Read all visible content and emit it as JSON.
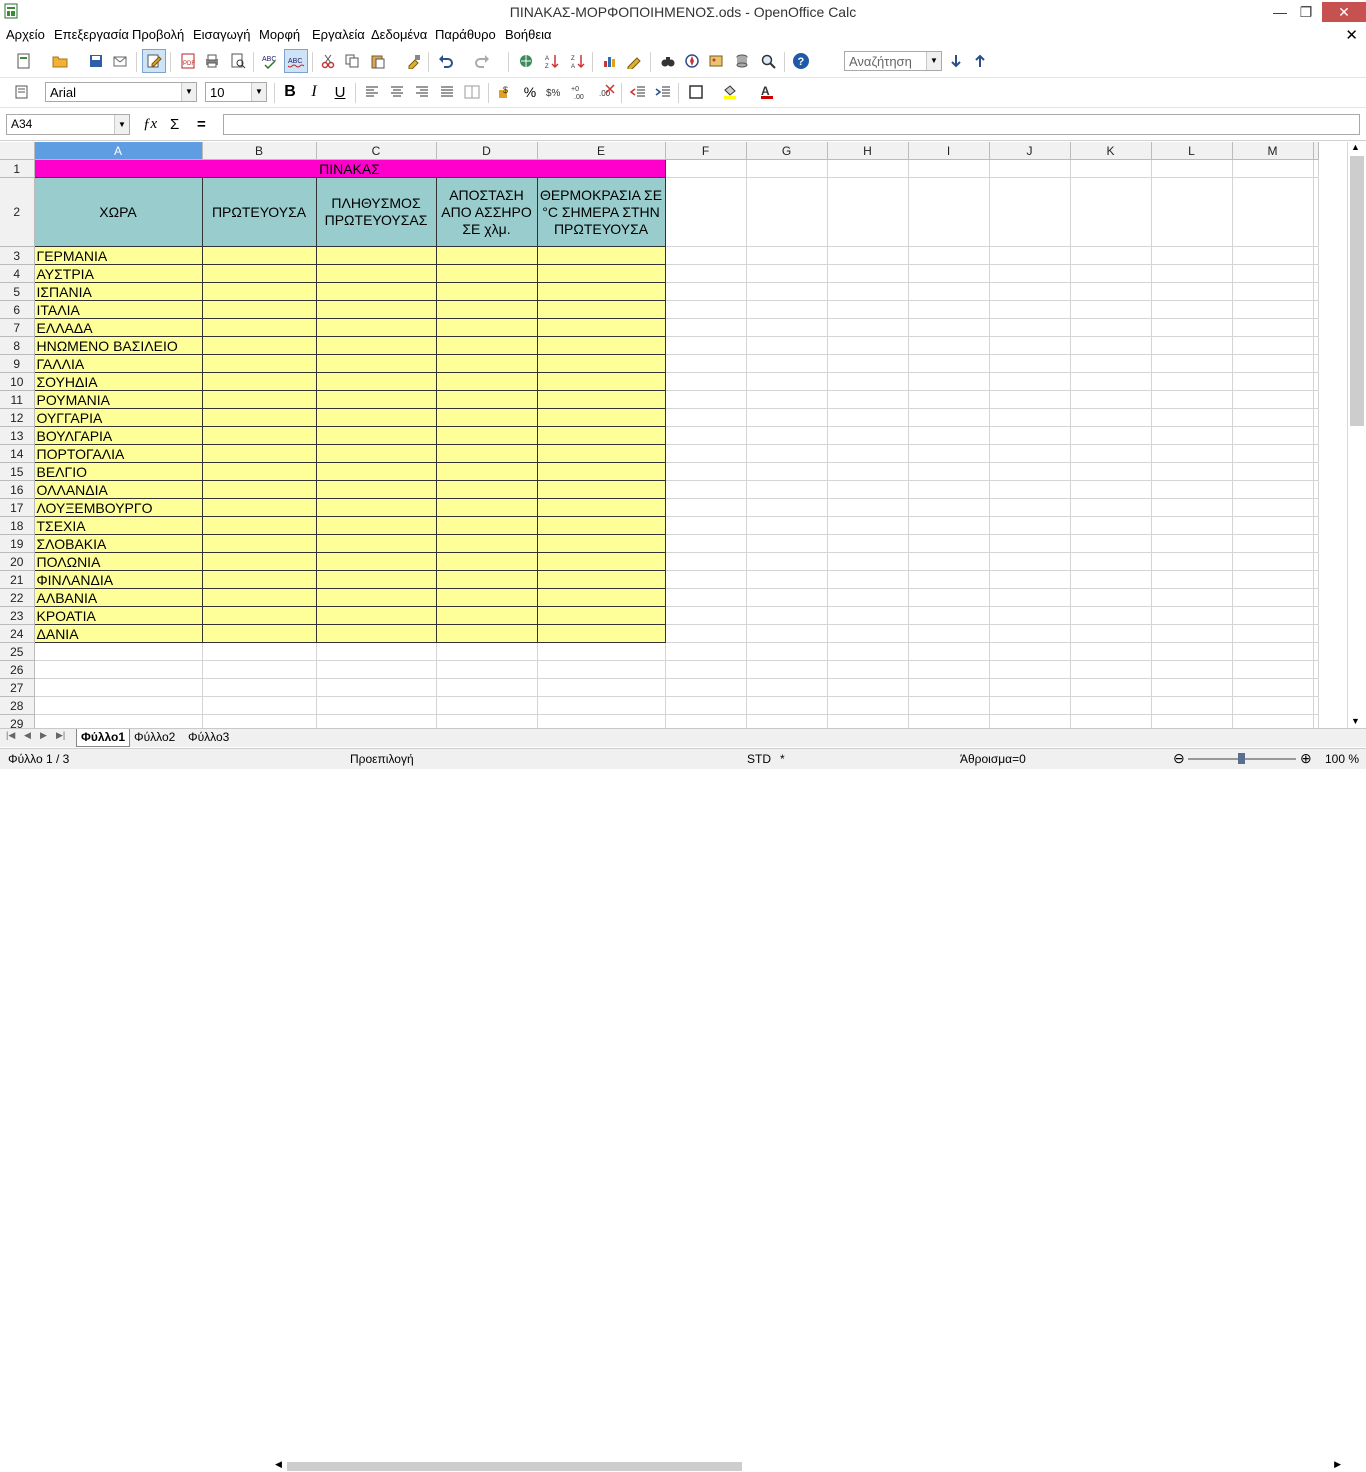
{
  "window": {
    "title": "ΠΙΝΑΚΑΣ-ΜΟΡΦΟΠΟΙΗΜΕΝΟΣ.ods - OpenOffice Calc",
    "minimize": "—",
    "maximize": "❐",
    "close": "✕"
  },
  "menu": [
    "Αρχείο",
    "Επεξεργασία",
    "Προβολή",
    "Εισαγωγή",
    "Μορφή",
    "Εργαλεία",
    "Δεδομένα",
    "Παράθυρο",
    "Βοήθεια"
  ],
  "toolbar": {
    "search_value": "Αναζήτηση",
    "font_name": "Arial",
    "font_size": "10"
  },
  "formula_bar": {
    "name_box": "A34",
    "equals": "="
  },
  "columns": [
    "A",
    "B",
    "C",
    "D",
    "E",
    "F",
    "G",
    "H",
    "I",
    "J",
    "K",
    "L",
    "M"
  ],
  "sheet": {
    "title_cell": "ΠΙΝΑΚΑΣ",
    "headers": [
      "ΧΩΡΑ",
      "ΠΡΩΤΕΥΟΥΣΑ",
      "ΠΛΗΘΥΣΜΟΣ ΠΡΩΤΕΥΟΥΣΑΣ",
      "ΑΠΟΣΤΑΣΗ ΑΠΟ ΑΣΣΗΡΟ ΣΕ χλμ.",
      "ΘΕΡΜΟΚΡΑΣΙΑ ΣΕ °C ΣΗΜΕΡΑ ΣΤΗΝ ΠΡΩΤΕΥΟΥΣΑ"
    ],
    "countries": [
      "ΓΕΡΜΑΝΙΑ",
      "ΑΥΣΤΡΙΑ",
      "ΙΣΠΑΝΙΑ",
      "ΙΤΑΛΙΑ",
      "ΕΛΛΑΔΑ",
      "ΗΝΩΜΕΝΟ ΒΑΣΙΛΕΙΟ",
      "ΓΑΛΛΙΑ",
      "ΣΟΥΗΔΙΑ",
      "ΡΟΥΜΑΝΙΑ",
      "ΟΥΓΓΑΡΙΑ",
      "ΒΟΥΛΓΑΡΙΑ",
      "ΠΟΡΤΟΓΑΛΙΑ",
      "ΒΕΛΓΙΟ",
      "ΟΛΛΑΝΔΙΑ",
      "ΛΟΥΞΕΜΒΟΥΡΓΟ",
      "ΤΣΕΧΙΑ",
      "ΣΛΟΒΑΚΙΑ",
      "ΠΟΛΩΝΙΑ",
      "ΦΙΝΛΑΝΔΙΑ",
      "ΑΛΒΑΝΙΑ",
      "ΚΡΟΑΤΙΑ",
      "ΔΑΝΙΑ"
    ],
    "empty_rows": [
      25,
      26,
      27,
      28,
      29
    ]
  },
  "sheet_tabs": [
    "Φύλλο1",
    "Φύλλο2",
    "Φύλλο3"
  ],
  "status": {
    "sheet": "Φύλλο 1 / 3",
    "style": "Προεπιλογή",
    "mode": "STD",
    "modified": "*",
    "sum": "Άθροισμα=0",
    "zoom": "100 %"
  },
  "colors": {
    "title_fill": "#ff00cc",
    "header_fill": "#99cccc",
    "data_fill": "#ffff99",
    "selected_column": "#5e9de2"
  }
}
